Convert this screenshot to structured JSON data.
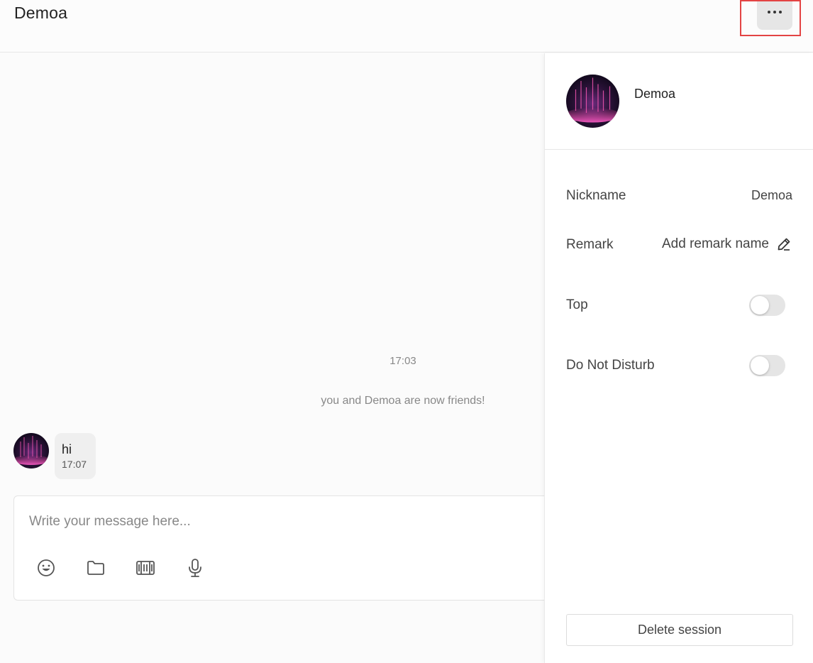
{
  "header": {
    "title": "Demoa",
    "more_icon": "more-horizontal-icon"
  },
  "chat": {
    "timestamp": "17:03",
    "system_message": "you and Demoa are now friends!",
    "messages": [
      {
        "sender": "Demoa",
        "text": "hi",
        "time": "17:07"
      }
    ]
  },
  "composer": {
    "placeholder": "Write your message here...",
    "value": "",
    "tools": [
      "emoji-icon",
      "folder-icon",
      "screenshot-icon",
      "microphone-icon"
    ]
  },
  "panel": {
    "profile": {
      "name": "Demoa"
    },
    "rows": {
      "nickname": {
        "label": "Nickname",
        "value": "Demoa"
      },
      "remark": {
        "label": "Remark",
        "value": "Add remark name",
        "icon": "edit-icon"
      },
      "top": {
        "label": "Top",
        "enabled": false
      },
      "dnd": {
        "label": "Do Not Disturb",
        "enabled": false
      }
    },
    "delete_label": "Delete session"
  },
  "colors": {
    "highlight_border": "#e34444",
    "toggle_off": "#e5e5e5",
    "bubble": "#efefef"
  }
}
